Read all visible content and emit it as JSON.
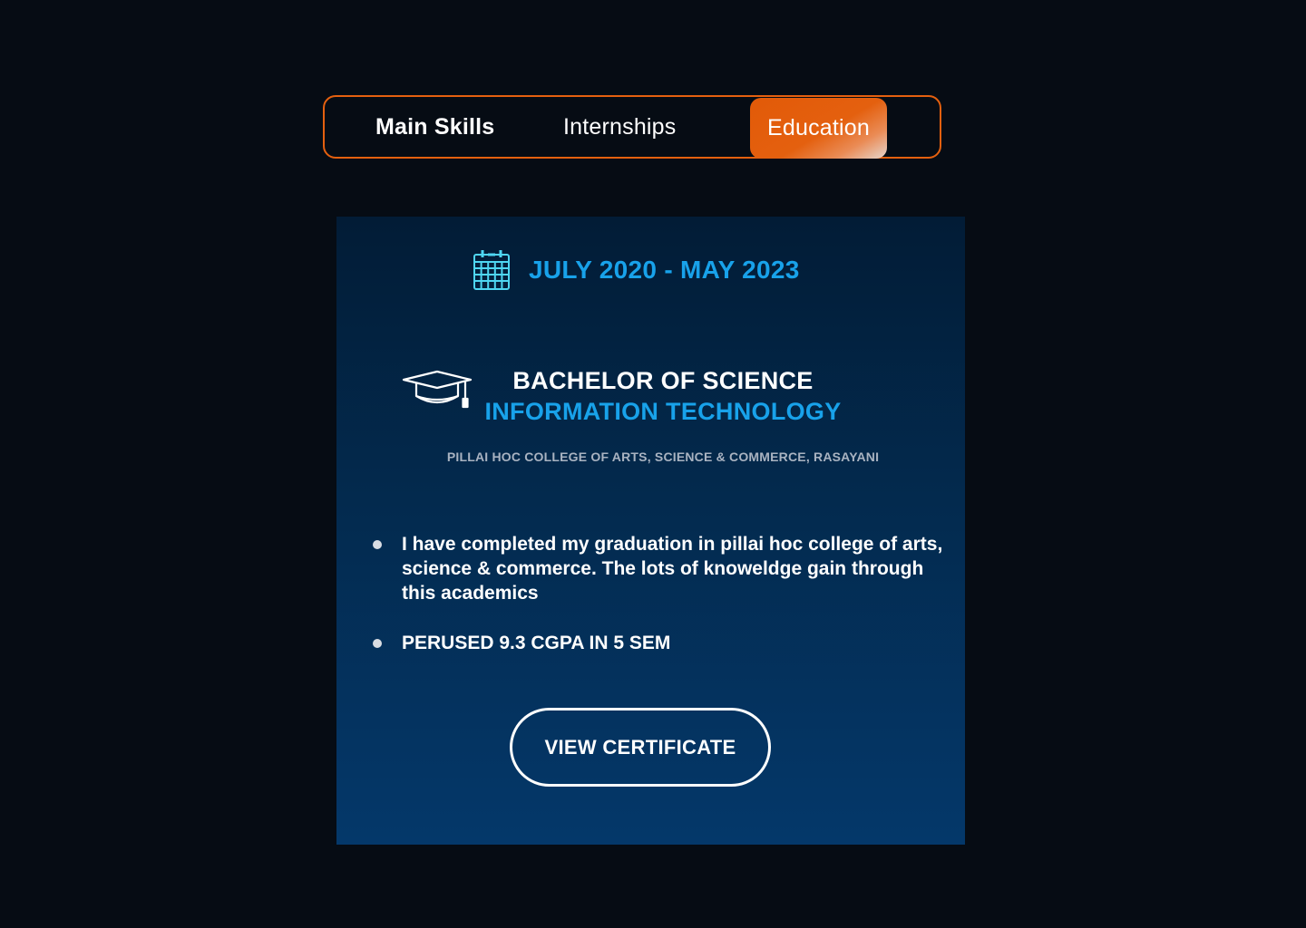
{
  "tabs": {
    "main_skills": "Main Skills",
    "internships": "Internships",
    "education": "Education",
    "active": "Education"
  },
  "education": {
    "date_range": "JULY 2020 - MAY 2023",
    "degree": "BACHELOR OF SCIENCE",
    "field": "INFORMATION TECHNOLOGY",
    "college": "PILLAI HOC COLLEGE OF ARTS, SCIENCE & COMMERCE, RASAYANI",
    "bullets": [
      "I have completed my graduation in pillai hoc college of arts, science & commerce. The lots of knoweldge gain through this academics",
      "PERUSED 9.3 CGPA IN 5 SEM"
    ],
    "certificate_button": "VIEW CERTIFICATE"
  },
  "icons": {
    "date": "calendar-icon",
    "degree": "graduation-cap-icon",
    "bullet": "bullet-dot-icon"
  },
  "colors": {
    "background": "#060c14",
    "accent_orange": "#e4600f",
    "accent_blue": "#18a2ea",
    "calendar_cyan": "#4fd6f2",
    "card_top": "#021c36",
    "card_bottom": "#04386a"
  }
}
